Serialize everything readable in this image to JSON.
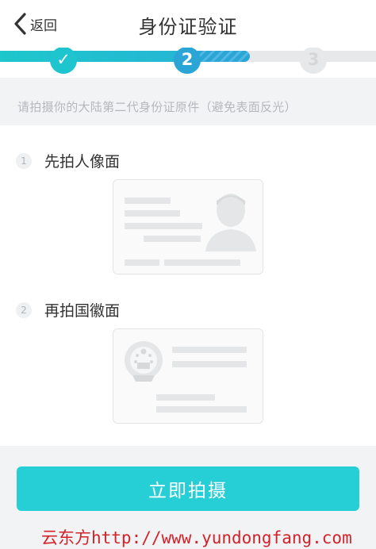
{
  "header": {
    "back_label": "返回",
    "title": "身份证验证"
  },
  "progress": {
    "current_step": 2,
    "total_steps": 3,
    "step_labels": [
      "✓",
      "2",
      "3"
    ],
    "colors": {
      "done": "#1fc6d0",
      "current": "#2ba4d6",
      "pending": "#e6e8ea"
    }
  },
  "hint": {
    "text": "请拍摄你的大陆第二代身份证原件（避免表面反光）"
  },
  "sections": [
    {
      "number": "1",
      "label": "先拍人像面"
    },
    {
      "number": "2",
      "label": "再拍国徽面"
    }
  ],
  "cta": {
    "label": "立即拍摄",
    "color": "#26cfd6"
  },
  "watermark": {
    "brand": "云东方",
    "url": "http://www.yundongfang.com"
  }
}
